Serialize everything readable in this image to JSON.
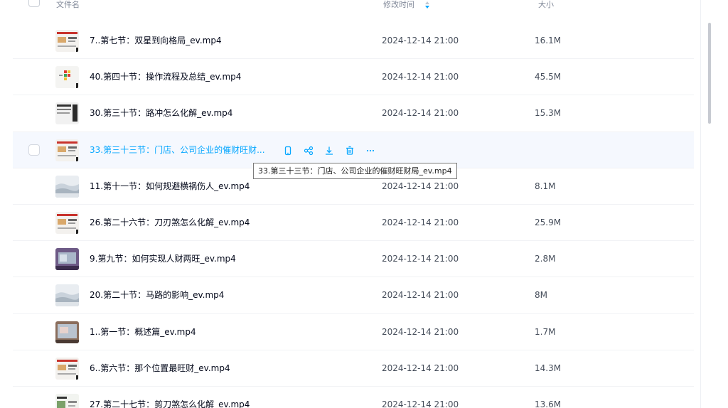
{
  "header": {
    "name_label": "文件名",
    "time_label": "修改时间",
    "size_label": "大小"
  },
  "rows": [
    {
      "name": "7..第七节：双星到向格局_ev.mp4",
      "time": "2024-12-14 21:00",
      "size": "16.1M",
      "thumb": "slide-red"
    },
    {
      "name": "40.第四十节：操作流程及总结_ev.mp4",
      "time": "2024-12-14 21:00",
      "size": "45.5M",
      "thumb": "slide-grid"
    },
    {
      "name": "30.第三十节：路冲怎么化解_ev.mp4",
      "time": "2024-12-14 21:00",
      "size": "15.3M",
      "thumb": "slide-dark"
    },
    {
      "name": "33.第三十三节：门店、公司企业的催财旺财...",
      "time": "",
      "size": "",
      "thumb": "slide-red",
      "hovered": true
    },
    {
      "name": "11.第十一节：如何规避横祸伤人_ev.mp4",
      "time": "2024-12-14 21:00",
      "size": "8.1M",
      "thumb": "landscape"
    },
    {
      "name": "26.第二十六节：刀刃煞怎么化解_ev.mp4",
      "time": "2024-12-14 21:00",
      "size": "25.9M",
      "thumb": "slide-red"
    },
    {
      "name": "9.第九节：如何实现人财两旺_ev.mp4",
      "time": "2024-12-14 21:00",
      "size": "2.8M",
      "thumb": "photo-purple"
    },
    {
      "name": "20.第二十节：马路的影响_ev.mp4",
      "time": "2024-12-14 21:00",
      "size": "8M",
      "thumb": "landscape"
    },
    {
      "name": "1..第一节：概述篇_ev.mp4",
      "time": "2024-12-14 21:00",
      "size": "1.7M",
      "thumb": "photo-pink"
    },
    {
      "name": "6..第六节：那个位置最旺财_ev.mp4",
      "time": "2024-12-14 21:00",
      "size": "14.3M",
      "thumb": "slide-red"
    },
    {
      "name": "27.第二十七节：剪刀煞怎么化解_ev.mp4",
      "time": "2024-12-14 21:00",
      "size": "13.6M",
      "thumb": "slide-green"
    }
  ],
  "tooltip": "33.第三十三节：门店、公司企业的催财旺财局_ev.mp4",
  "actions": [
    "phone-icon",
    "share-icon",
    "download-icon",
    "delete-icon",
    "more-icon"
  ],
  "colors": {
    "accent": "#06a7ff",
    "hover_bg": "#f5f8fe",
    "divider": "#f1f2f5",
    "text": "#03081a",
    "muted": "#818999"
  }
}
